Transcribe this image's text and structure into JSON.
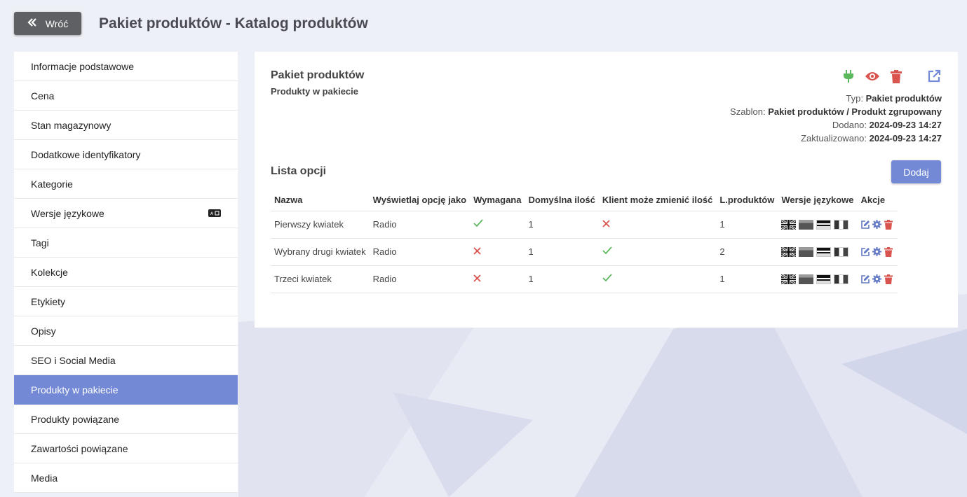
{
  "header": {
    "back_label": "Wróć",
    "title": "Pakiet produktów - Katalog produktów"
  },
  "sidebar": {
    "items": [
      {
        "label": "Informacje podstawowe"
      },
      {
        "label": "Cena"
      },
      {
        "label": "Stan magazynowy"
      },
      {
        "label": "Dodatkowe identyfikatory"
      },
      {
        "label": "Kategorie"
      },
      {
        "label": "Wersje językowe",
        "icon": "language-icon"
      },
      {
        "label": "Tagi"
      },
      {
        "label": "Kolekcje"
      },
      {
        "label": "Etykiety"
      },
      {
        "label": "Opisy"
      },
      {
        "label": "SEO i Social Media"
      },
      {
        "label": "Produkty w pakiecie",
        "active": true
      },
      {
        "label": "Produkty powiązane"
      },
      {
        "label": "Zawartości powiązane"
      },
      {
        "label": "Media"
      }
    ]
  },
  "panel": {
    "title": "Pakiet produktów",
    "subtitle": "Produkty w pakiecie",
    "icons": [
      "plugin-icon",
      "eye-icon",
      "trash-icon",
      "external-link-icon"
    ],
    "meta": {
      "type_label": "Typ:",
      "type_value": "Pakiet produktów",
      "template_label": "Szablon:",
      "template_value": "Pakiet produktów / Produkt zgrupowany",
      "added_label": "Dodano:",
      "added_value": "2024-09-23 14:27",
      "updated_label": "Zaktualizowano:",
      "updated_value": "2024-09-23 14:27"
    },
    "list_title": "Lista opcji",
    "add_label": "Dodaj",
    "table": {
      "headers": [
        "Nazwa",
        "Wyświetlaj opcję jako",
        "Wymagana",
        "Domyślna ilość",
        "Klient może zmienić ilość",
        "L.produktów",
        "Wersje językowe",
        "Akcje"
      ],
      "rows": [
        {
          "name": "Pierwszy kwiatek",
          "display": "Radio",
          "required": true,
          "default_qty": "1",
          "client_change": false,
          "count": "1"
        },
        {
          "name": "Wybrany drugi kwiatek",
          "display": "Radio",
          "required": false,
          "default_qty": "1",
          "client_change": true,
          "count": "2"
        },
        {
          "name": "Trzeci kwiatek",
          "display": "Radio",
          "required": false,
          "default_qty": "1",
          "client_change": true,
          "count": "1"
        }
      ]
    }
  },
  "colors": {
    "accent": "#7389d6",
    "check": "#5cb85c",
    "cross": "#d9534f",
    "link": "#6479c4"
  }
}
